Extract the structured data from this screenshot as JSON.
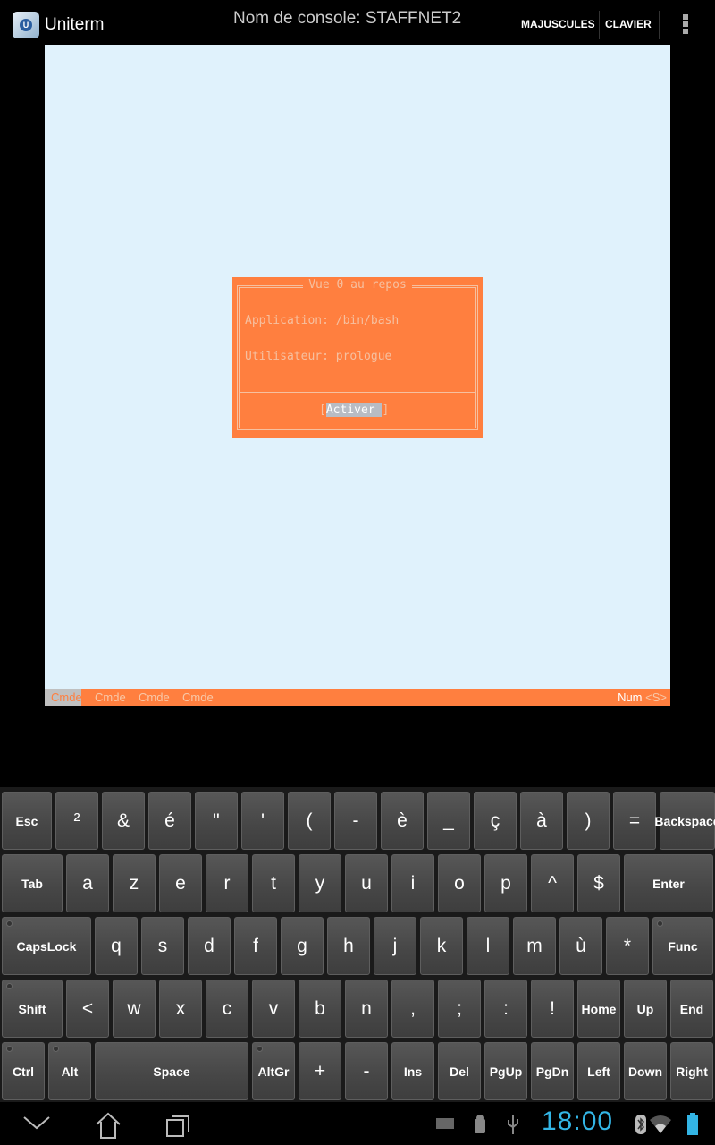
{
  "action_bar": {
    "app_title": "Uniterm",
    "app_icon": "uniterm-logo",
    "console_name": "Nom de console: STAFFNET2",
    "majuscules_label": "MAJUSCULES",
    "clavier_label": "CLAVIER",
    "overflow_icon": "overflow-menu-icon"
  },
  "dialog": {
    "title": "Vue 0 au repos",
    "application": "Application: /bin/bash",
    "utilisateur": "Utilisateur: prologue",
    "button_open": "[",
    "button_label": "Activer ",
    "button_close": "]"
  },
  "status_bar": {
    "cmds": [
      "Cmde",
      "Cmde",
      "Cmde",
      "Cmde"
    ],
    "num": "Num",
    "indicator": "<S>"
  },
  "keyboard": {
    "rows": [
      [
        "Esc",
        "²",
        "&",
        "é",
        "\"",
        "'",
        "(",
        "-",
        "è",
        "_",
        "ç",
        "à",
        ")",
        "=",
        "Backspace"
      ],
      [
        "Tab",
        "a",
        "z",
        "e",
        "r",
        "t",
        "y",
        "u",
        "i",
        "o",
        "p",
        "^",
        "$",
        "Enter"
      ],
      [
        "CapsLock",
        "q",
        "s",
        "d",
        "f",
        "g",
        "h",
        "j",
        "k",
        "l",
        "m",
        "ù",
        "*",
        "Func"
      ],
      [
        "Shift",
        "<",
        "w",
        "x",
        "c",
        "v",
        "b",
        "n",
        ",",
        ";",
        ":",
        "!",
        "Home",
        "Up",
        "End"
      ],
      [
        "Ctrl",
        "Alt",
        "Space",
        "AltGr",
        "+",
        "-",
        "Ins",
        "Del",
        "PgUp",
        "PgDn",
        "Left",
        "Down",
        "Right"
      ]
    ]
  },
  "system_bar": {
    "clock": "18:00",
    "icons": [
      "back-icon",
      "home-icon",
      "recent-apps-icon",
      "keyboard-icon",
      "android-debug-icon",
      "usb-icon",
      "bluetooth-icon",
      "wifi-icon",
      "battery-icon"
    ],
    "accent": "#33b5e5"
  },
  "colors": {
    "terminal_bg": "#e0f2fc",
    "dialog_bg": "#ff7f3f"
  }
}
